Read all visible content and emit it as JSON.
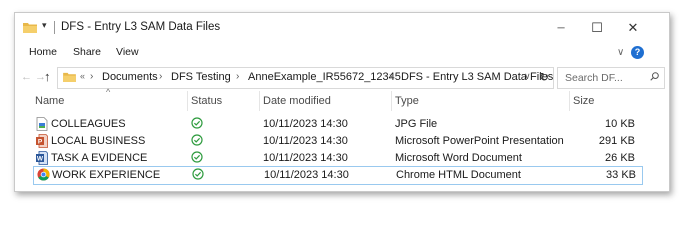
{
  "window": {
    "title": "DFS - Entry L3 SAM Data Files",
    "quick_access_glyph": "▾",
    "minimize_glyph": "─",
    "maximize_glyph": "☐",
    "close_glyph": "✕"
  },
  "ribbon": {
    "tabs": [
      "Home",
      "Share",
      "View"
    ],
    "expand_glyph": "∨",
    "help_glyph": "?"
  },
  "nav": {
    "back_glyph": "←",
    "forward_glyph": "→",
    "up_glyph": "↑",
    "overflow_glyph": "«",
    "breadcrumbs": [
      "Documents",
      "DFS Testing",
      "AnneExample_IR55672_12345",
      "DFS - Entry L3 SAM Data Files"
    ],
    "separator_glyph": "›",
    "dropdown_glyph": "∨",
    "refresh_glyph": "↻",
    "search_placeholder": "Search DF..."
  },
  "columns": {
    "sort_glyph": "^",
    "name": "Name",
    "status": "Status",
    "date": "Date modified",
    "type": "Type",
    "size": "Size"
  },
  "files": [
    {
      "name": "COLLEAGUES",
      "status_icon": "synced-check-icon",
      "date": "10/11/2023 14:30",
      "type": "JPG File",
      "size": "10 KB",
      "icon": "jpg-file-icon"
    },
    {
      "name": "LOCAL BUSINESS",
      "status_icon": "synced-check-icon",
      "date": "10/11/2023 14:30",
      "type": "Microsoft PowerPoint Presentation",
      "size": "291 KB",
      "icon": "powerpoint-file-icon"
    },
    {
      "name": "TASK A EVIDENCE",
      "status_icon": "synced-check-icon",
      "date": "10/11/2023 14:30",
      "type": "Microsoft Word Document",
      "size": "26 KB",
      "icon": "word-file-icon"
    },
    {
      "name": "WORK EXPERIENCE",
      "status_icon": "synced-check-icon",
      "date": "10/11/2023 14:30",
      "type": "Chrome HTML Document",
      "size": "33 KB",
      "icon": "chrome-file-icon"
    }
  ],
  "colors": {
    "folder": "#e8b84a",
    "status_check": "#2e9b3e",
    "selection_border": "#99c9ef",
    "help": "#1f6fd1"
  }
}
